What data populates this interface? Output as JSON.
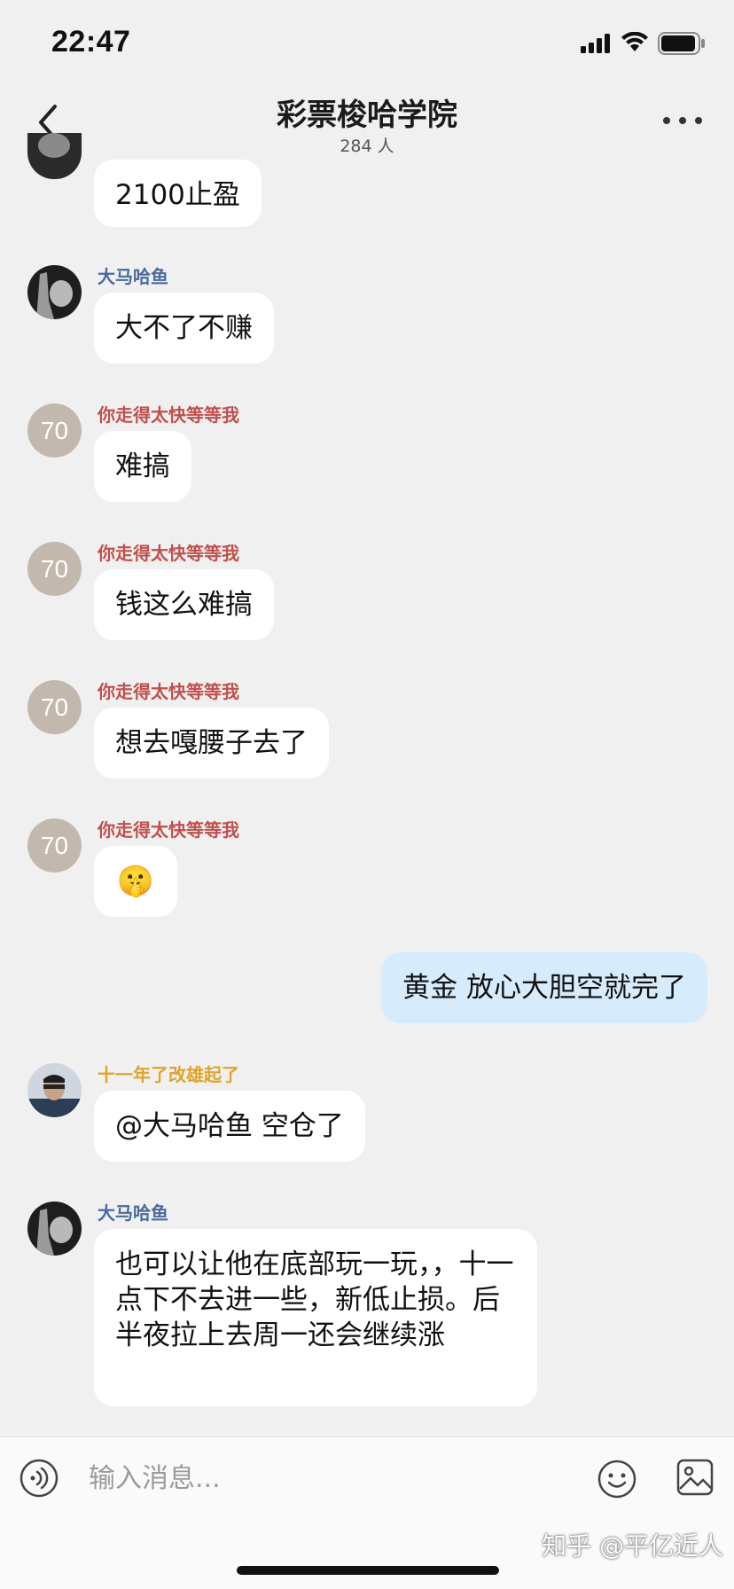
{
  "status_bar": {
    "time": "22:47",
    "icons": [
      "cellular-signal-icon",
      "wifi-icon",
      "battery-icon"
    ]
  },
  "header": {
    "back_icon": "chevron-left-icon",
    "title": "彩票梭哈学院",
    "member_count": "284 人",
    "more_icon": "more-dots-icon"
  },
  "messages": [
    {
      "sender": "",
      "avatar": "photo",
      "text": "2100止盈",
      "mine": false
    },
    {
      "sender": "大马哈鱼",
      "sender_color": "#4a6a9c",
      "avatar": "photo",
      "text": "大不了不赚",
      "mine": false
    },
    {
      "sender": "你走得太快等等我",
      "sender_color": "#c0504d",
      "avatar": "70",
      "text": "难搞",
      "mine": false
    },
    {
      "sender": "你走得太快等等我",
      "sender_color": "#c0504d",
      "avatar": "70",
      "text": "钱这么难搞",
      "mine": false
    },
    {
      "sender": "你走得太快等等我",
      "sender_color": "#c0504d",
      "avatar": "70",
      "text": "想去嘎腰子去了",
      "mine": false
    },
    {
      "sender": "你走得太快等等我",
      "sender_color": "#c0504d",
      "avatar": "70",
      "text": "🤫",
      "mine": false
    },
    {
      "sender": "",
      "avatar": "",
      "text": "黄金 放心大胆空就完了",
      "mine": true
    },
    {
      "sender": "十一年了改雄起了",
      "sender_color": "#e0a42a",
      "avatar": "photo",
      "text": "@大马哈鱼 空仓了",
      "mine": false
    },
    {
      "sender": "大马哈鱼",
      "sender_color": "#4a6a9c",
      "avatar": "photo",
      "text": "也可以让他在底部玩一玩，，十一点下不去进一些，新低止损。后半夜拉上去周一还会继续涨",
      "mine": false
    }
  ],
  "input_bar": {
    "voice_icon": "voice-input-icon",
    "placeholder": "输入消息...",
    "emoji_icon": "emoji-icon",
    "image_icon": "image-icon"
  },
  "watermark": "知乎 @平亿近人",
  "colors": {
    "background": "#f0f0f0",
    "bubble_other": "#ffffff",
    "bubble_mine": "#d6ecfd",
    "avatar_70": "#c2b8ad"
  }
}
